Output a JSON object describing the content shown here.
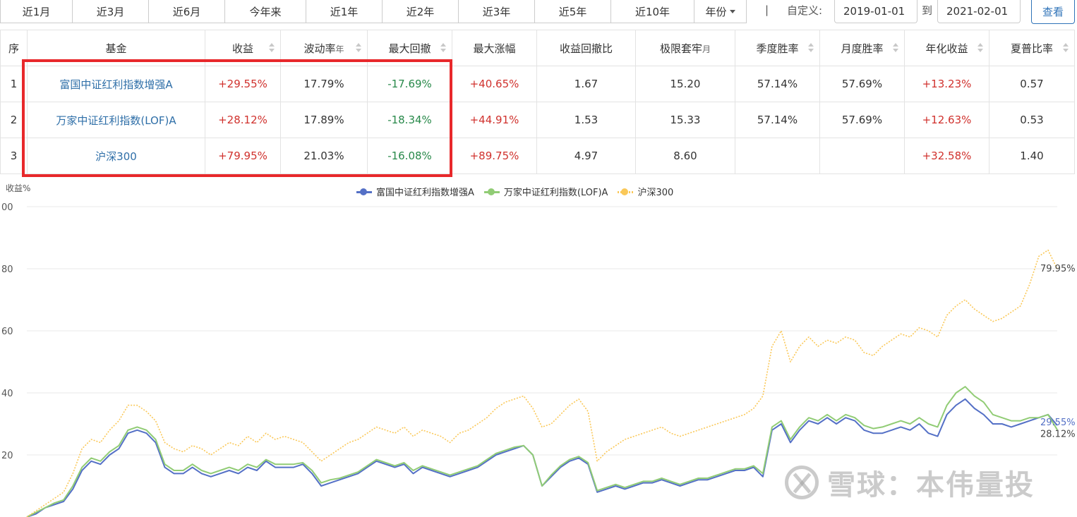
{
  "toolbar": {
    "ranges": [
      "近1月",
      "近3月",
      "近6月",
      "今年来",
      "近1年",
      "近2年",
      "近3年",
      "近5年",
      "近10年"
    ],
    "year_label": "年份",
    "separator": "|",
    "custom_label": "自定义:",
    "start_date": "2019-01-01",
    "to_label": "到",
    "end_date": "2021-02-01",
    "query_label": "查看"
  },
  "table": {
    "headers": {
      "index": "序",
      "fund": "基金",
      "return": "收益",
      "volatility": "波动率",
      "volatility_unit": "年",
      "max_drawdown": "最大回撤",
      "max_gain": "最大涨幅",
      "return_drawdown_ratio": "收益回撤比",
      "max_stuck": "极限套牢",
      "max_stuck_unit": "月",
      "quarter_win": "季度胜率",
      "month_win": "月度胜率",
      "annual_return": "年化收益",
      "sharpe": "夏普比率"
    },
    "rows": [
      {
        "index": "1",
        "fund": "富国中证红利指数增强A",
        "return": "+29.55%",
        "volatility": "17.79%",
        "max_drawdown": "-17.69%",
        "max_gain": "+40.65%",
        "rd_ratio": "1.67",
        "max_stuck": "15.20",
        "quarter_win": "57.14%",
        "month_win": "57.69%",
        "annual_return": "+13.23%",
        "sharpe": "0.57"
      },
      {
        "index": "2",
        "fund": "万家中证红利指数(LOF)A",
        "return": "+28.12%",
        "volatility": "17.89%",
        "max_drawdown": "-18.34%",
        "max_gain": "+44.91%",
        "rd_ratio": "1.53",
        "max_stuck": "15.33",
        "quarter_win": "57.14%",
        "month_win": "57.69%",
        "annual_return": "+12.63%",
        "sharpe": "0.53"
      },
      {
        "index": "3",
        "fund": "沪深300",
        "return": "+79.95%",
        "volatility": "21.03%",
        "max_drawdown": "-16.08%",
        "max_gain": "+89.75%",
        "rd_ratio": "4.97",
        "max_stuck": "8.60",
        "quarter_win": "",
        "month_win": "",
        "annual_return": "+32.58%",
        "sharpe": "1.40"
      }
    ]
  },
  "colors": {
    "positive": "#d0312d",
    "negative": "#28894a",
    "link": "#2f6fa8",
    "highlight_box": "#e8282b",
    "accent": "#2f73b8"
  },
  "chart_data": {
    "type": "line",
    "ylabel": "收益%",
    "y_ticks": [
      "00",
      "80",
      "60",
      "40",
      "20"
    ],
    "ylim": [
      0,
      100
    ],
    "grid": true,
    "legend_position": "top-center",
    "series": [
      {
        "name": "富国中证红利指数增强A",
        "color": "#5470c6",
        "style": "solid",
        "end_label": "29.55%",
        "values": [
          0,
          1,
          3,
          4,
          5,
          9,
          15,
          18,
          17,
          20,
          22,
          27,
          28,
          27,
          24,
          16,
          14,
          14,
          16,
          14,
          13,
          14,
          15,
          14,
          16,
          15,
          18,
          16,
          16,
          16,
          17,
          14,
          10,
          11,
          12,
          13,
          14,
          16,
          18,
          17,
          16,
          17,
          14,
          16,
          15,
          14,
          13,
          14,
          15,
          16,
          18,
          20,
          21,
          22,
          23,
          20,
          10,
          13,
          16,
          18,
          19,
          17,
          8,
          9,
          10,
          9,
          10,
          11,
          11,
          12,
          11,
          10,
          11,
          12,
          12,
          13,
          14,
          15,
          15,
          16,
          13,
          28,
          30,
          24,
          28,
          31,
          30,
          32,
          30,
          32,
          31,
          28,
          27,
          27,
          28,
          29,
          28,
          30,
          27,
          26,
          33,
          36,
          38,
          35,
          33,
          30,
          30,
          29,
          30,
          31,
          32,
          33,
          29.55
        ]
      },
      {
        "name": "万家中证红利指数(LOF)A",
        "color": "#91cc75",
        "style": "solid",
        "end_label": "28.12%",
        "values": [
          0,
          1.5,
          3,
          4.5,
          5.5,
          10,
          16,
          19,
          18,
          21,
          23,
          28,
          29,
          28,
          25,
          17,
          15,
          15,
          17,
          15,
          14,
          15,
          16,
          15,
          17,
          16,
          18.5,
          17,
          17,
          17,
          17.5,
          15,
          11,
          12,
          12.5,
          13.5,
          14.5,
          16.5,
          18.5,
          17.5,
          16.5,
          17.5,
          15,
          16.5,
          15.5,
          14.5,
          13.5,
          14.5,
          15.5,
          16.5,
          18.5,
          20.5,
          21.5,
          22.5,
          23,
          20,
          10,
          13.5,
          16.5,
          18.5,
          19.5,
          17.5,
          8.5,
          9.5,
          10.5,
          9.5,
          10.5,
          11.5,
          11.5,
          12.5,
          11.5,
          10.5,
          11.5,
          12.5,
          12.5,
          13.5,
          14.5,
          15.5,
          15.5,
          16.5,
          14,
          29,
          31,
          25,
          29,
          32,
          31,
          33,
          31,
          33,
          32,
          29.5,
          28.5,
          29,
          30,
          31,
          30,
          32,
          30,
          29,
          36,
          40,
          42,
          39,
          37,
          33,
          32,
          31,
          31,
          32,
          32,
          33,
          28.12
        ]
      },
      {
        "name": "沪深300",
        "color": "#fac858",
        "style": "dotted",
        "end_label": "79.95%",
        "values": [
          0,
          2,
          4,
          6,
          8,
          14,
          22,
          25,
          24,
          28,
          31,
          36,
          36,
          34,
          31,
          24,
          22,
          21,
          23,
          22,
          20,
          22,
          24,
          23,
          26,
          24,
          27,
          25,
          26,
          25,
          24,
          21,
          18,
          20,
          22,
          24,
          25,
          27,
          29,
          28,
          27,
          29,
          26,
          28,
          27,
          26,
          24,
          27,
          28,
          30,
          32,
          35,
          37,
          38,
          39,
          35,
          29,
          30,
          33,
          36,
          38,
          34,
          18,
          21,
          23,
          25,
          26,
          27,
          28,
          29,
          27,
          26,
          27,
          28,
          29,
          30,
          31,
          32,
          33,
          35,
          39,
          55,
          60,
          50,
          55,
          58,
          55,
          57,
          56,
          58,
          57,
          53,
          52,
          55,
          57,
          59,
          58,
          61,
          60,
          58,
          65,
          68,
          70,
          67,
          65,
          63,
          64,
          66,
          68,
          75,
          84,
          86,
          79.95
        ]
      }
    ]
  },
  "watermark": {
    "text": "雪球：本伟量投"
  }
}
